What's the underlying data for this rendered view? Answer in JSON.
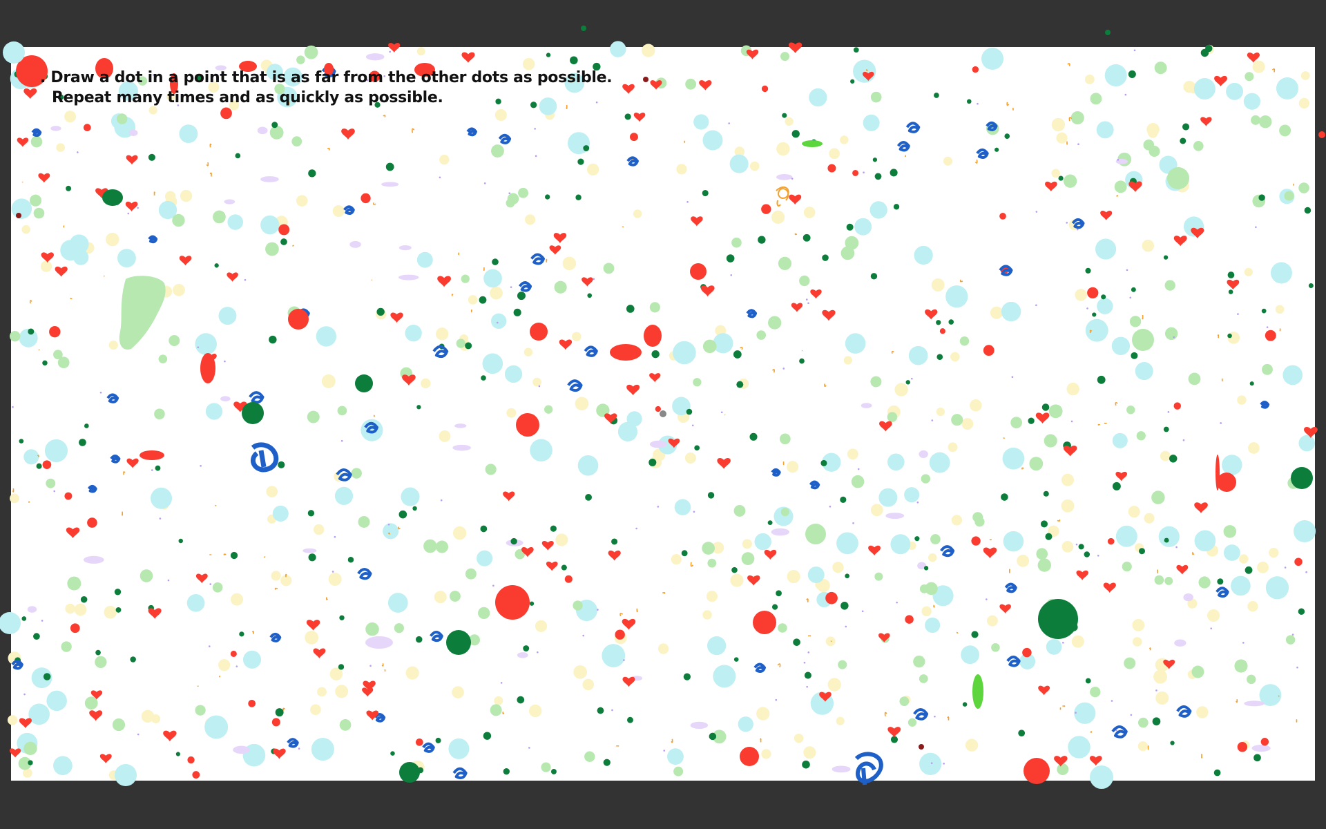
{
  "instructions": {
    "line1": ". Draw a dot in a point that is as far from the other dots as possible.",
    "line2": "Repeat many times and as quickly as possible."
  },
  "colors": {
    "background": "#333333",
    "canvas": "#ffffff",
    "red": "#f93c2f",
    "dark_green": "#0c7d3b",
    "light_green": "#b6e8b0",
    "light_blue": "#bdeff3",
    "pale_yellow": "#fbf3c4",
    "blue_scribble": "#1f60c8",
    "orange_stroke": "#f4a02a",
    "lavender": "#e6d6fa",
    "lime": "#5cd63c"
  },
  "dot_kinds": [
    "heart-icon",
    "red-dot",
    "green-dot",
    "light-green-dot",
    "light-blue-dot",
    "yellow-dot",
    "blue-scribble",
    "orange-stroke",
    "lavender-blob"
  ]
}
